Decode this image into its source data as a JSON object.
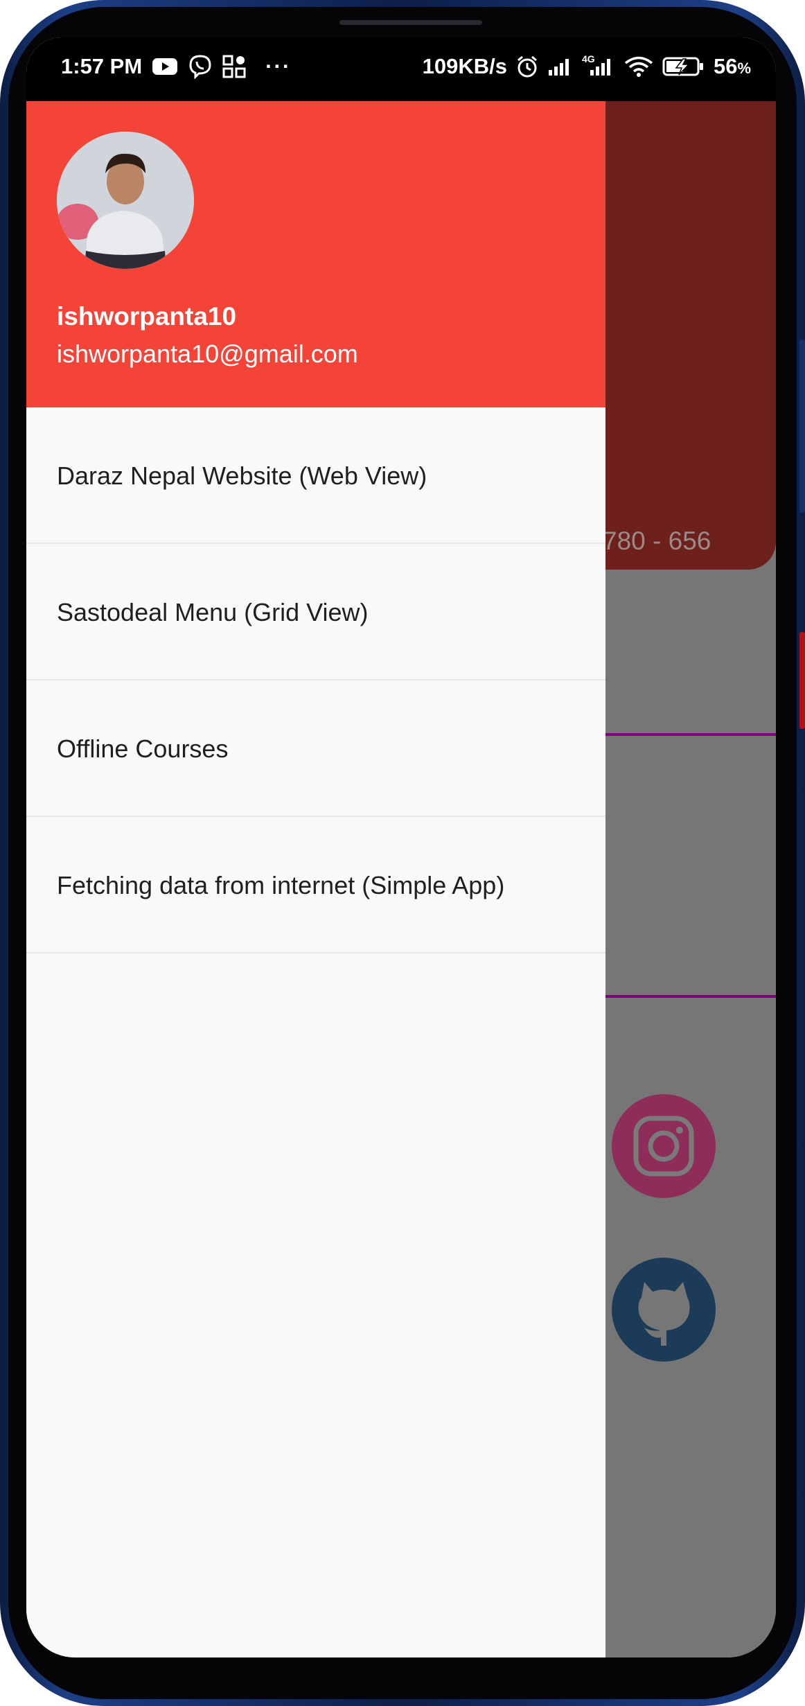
{
  "status_bar": {
    "time": "1:57 PM",
    "overflow_dots": "···",
    "net_speed": "109KB/s",
    "network_badge": "4G",
    "battery": "56",
    "battery_unit": "%",
    "left_icons": [
      "youtube-icon",
      "viber-icon",
      "apps-icon"
    ],
    "right_icons": [
      "alarm-icon",
      "signal-icon",
      "signal-4g-icon",
      "wifi-icon",
      "battery-charging-icon"
    ]
  },
  "background_app": {
    "phone_partial": "780 - 656",
    "social_icons": [
      "instagram-icon",
      "github-icon"
    ],
    "colors": {
      "card": "#6e211c",
      "divider": "#800080",
      "scrim": "#767676"
    }
  },
  "drawer": {
    "header": {
      "username": "ishworpanta10",
      "email": "ishworpanta10@gmail.com",
      "bg_color": "#f44438"
    },
    "items": [
      {
        "label": "Daraz Nepal Website (Web View)"
      },
      {
        "label": "Sastodeal Menu (Grid View)"
      },
      {
        "label": "Offline Courses"
      },
      {
        "label": "Fetching data from internet (Simple App)"
      }
    ]
  }
}
